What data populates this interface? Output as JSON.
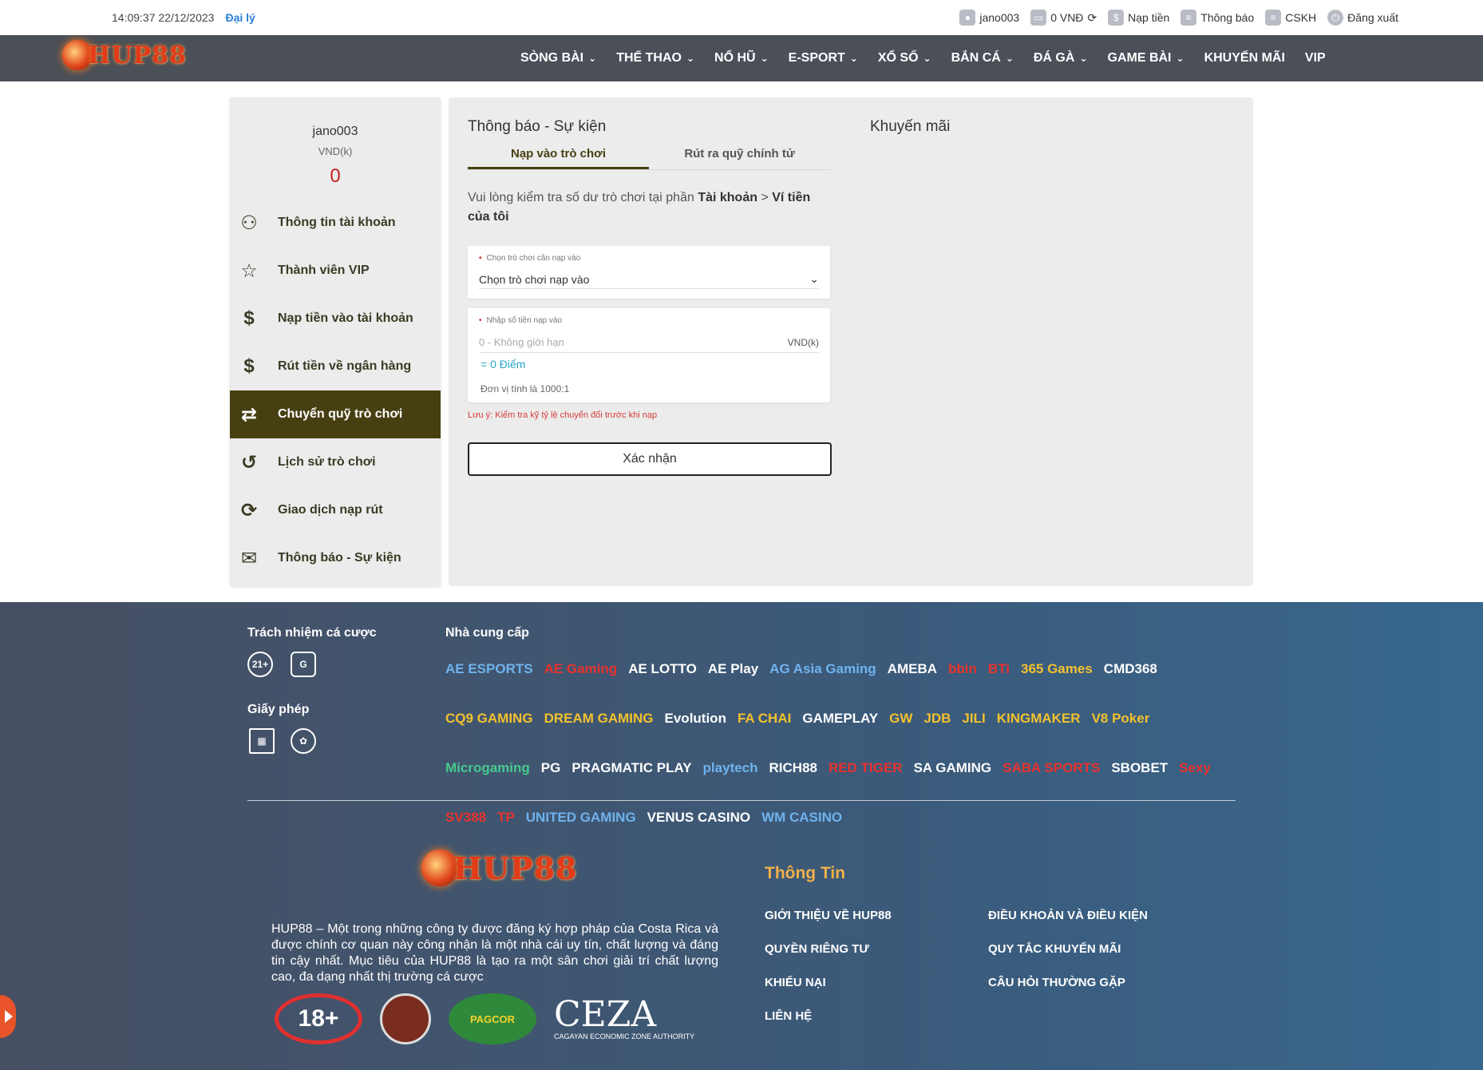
{
  "topbar": {
    "datetime": "14:09:37 22/12/2023",
    "agent": "Đại lý",
    "username": "jano003",
    "balance": "0 VNĐ",
    "deposit": "Nạp tiền",
    "notice": "Thông báo",
    "support": "CSKH",
    "logout": "Đăng xuất"
  },
  "nav": {
    "logo": "HUP88",
    "items": [
      "SÒNG BÀI",
      "THỂ THAO",
      "NỔ HŨ",
      "E-SPORT",
      "XỔ SỐ",
      "BẮN CÁ",
      "ĐÁ GÀ",
      "GAME BÀI",
      "KHUYẾN MÃI",
      "VIP"
    ]
  },
  "sidebar": {
    "username": "jano003",
    "currency": "VND(k)",
    "balance": "0",
    "items": [
      {
        "label": "Thông tin tài khoản",
        "icon": "user-icon"
      },
      {
        "label": "Thành viên VIP",
        "icon": "star-icon"
      },
      {
        "label": "Nạp tiền vào tài khoản",
        "icon": "deposit-icon"
      },
      {
        "label": "Rút tiền về ngân hàng",
        "icon": "dollar-icon"
      },
      {
        "label": "Chuyển quỹ trò chơi",
        "icon": "transfer-icon"
      },
      {
        "label": "Lịch sử trò chơi",
        "icon": "history-icon"
      },
      {
        "label": "Giao dịch nạp rút",
        "icon": "refresh-icon"
      },
      {
        "label": "Thông báo - Sự kiện",
        "icon": "mail-icon"
      }
    ]
  },
  "panel": {
    "title": "Thông báo - Sự kiện",
    "promo_title": "Khuyến mãi",
    "tabs": [
      "Nạp vào trò chơi",
      "Rút ra quỹ chính tử"
    ],
    "notice_prefix": "Vui lòng kiểm tra số dư trò chơi tại phần ",
    "notice_bold1": "Tài khoản",
    "notice_sep": " > ",
    "notice_bold2": "Ví tiền của tôi",
    "game_label": "Chọn trò chơi cần nạp vào",
    "game_select": "Chọn trò chơi nạp vào",
    "amount_label": "Nhập số tiền nạp vào",
    "amount_placeholder": "0 - Không giới hạn",
    "amount_unit": "VND(k)",
    "points": "= 0 Điểm",
    "rate": "Đơn vị tính là 1000:1",
    "warning": "Lưu ý: Kiểm tra kỹ tỷ lệ chuyển đổi trước khi nạp",
    "confirm": "Xác nhận"
  },
  "footer": {
    "responsible_title": "Trách nhiệm cá cược",
    "responsible_badges": [
      "21+",
      "G"
    ],
    "license_title": "Giấy phép",
    "providers_title": "Nhà cung cấp",
    "providers": [
      "AE ESPORTS",
      "AE Gaming",
      "AE LOTTO",
      "AE Play",
      "AG Asia Gaming",
      "AMEBA",
      "bbin",
      "BTi",
      "365 Games",
      "CMD368",
      "CQ9 GAMING",
      "DREAM GAMING",
      "Evolution",
      "FA CHAI",
      "GAMEPLAY",
      "GW",
      "JDB",
      "JILI",
      "KINGMAKER",
      "V8 Poker",
      "Microgaming",
      "PG",
      "PRAGMATIC PLAY",
      "playtech",
      "RICH88",
      "RED TIGER",
      "SA GAMING",
      "SABA SPORTS",
      "SBOBET",
      "Sexy",
      "SV388",
      "TP",
      "UNITED GAMING",
      "VENUS CASINO",
      "WM CASINO"
    ],
    "logo": "HUP88",
    "about": "HUP88 – Một trong những công ty được đăng ký hợp pháp của Costa Rica và được chính cơ quan này công nhận là một nhà cái uy tín, chất lượng và đáng tin cậy nhất. Mục tiêu của HUP88 là tạo ra một sân chơi giải trí chất lượng cao, đa dạng nhất thị trường cá cược",
    "badge_18": "18+",
    "badge_pagcor": "PAGCOR",
    "ceza": "CEZA",
    "ceza_sub": "CAGAYAN ECONOMIC ZONE AUTHORITY",
    "info_title": "Thông Tin",
    "links": [
      "GIỚI THIỆU VỀ HUP88",
      "ĐIỀU KHOẢN VÀ ĐIỀU KIỆN",
      "QUYỀN RIÊNG TƯ",
      "QUY TẮC KHUYẾN MÃI",
      "KHIẾU NẠI",
      "CÂU HỎI THƯỜNG GẶP",
      "LIÊN HỆ"
    ]
  }
}
